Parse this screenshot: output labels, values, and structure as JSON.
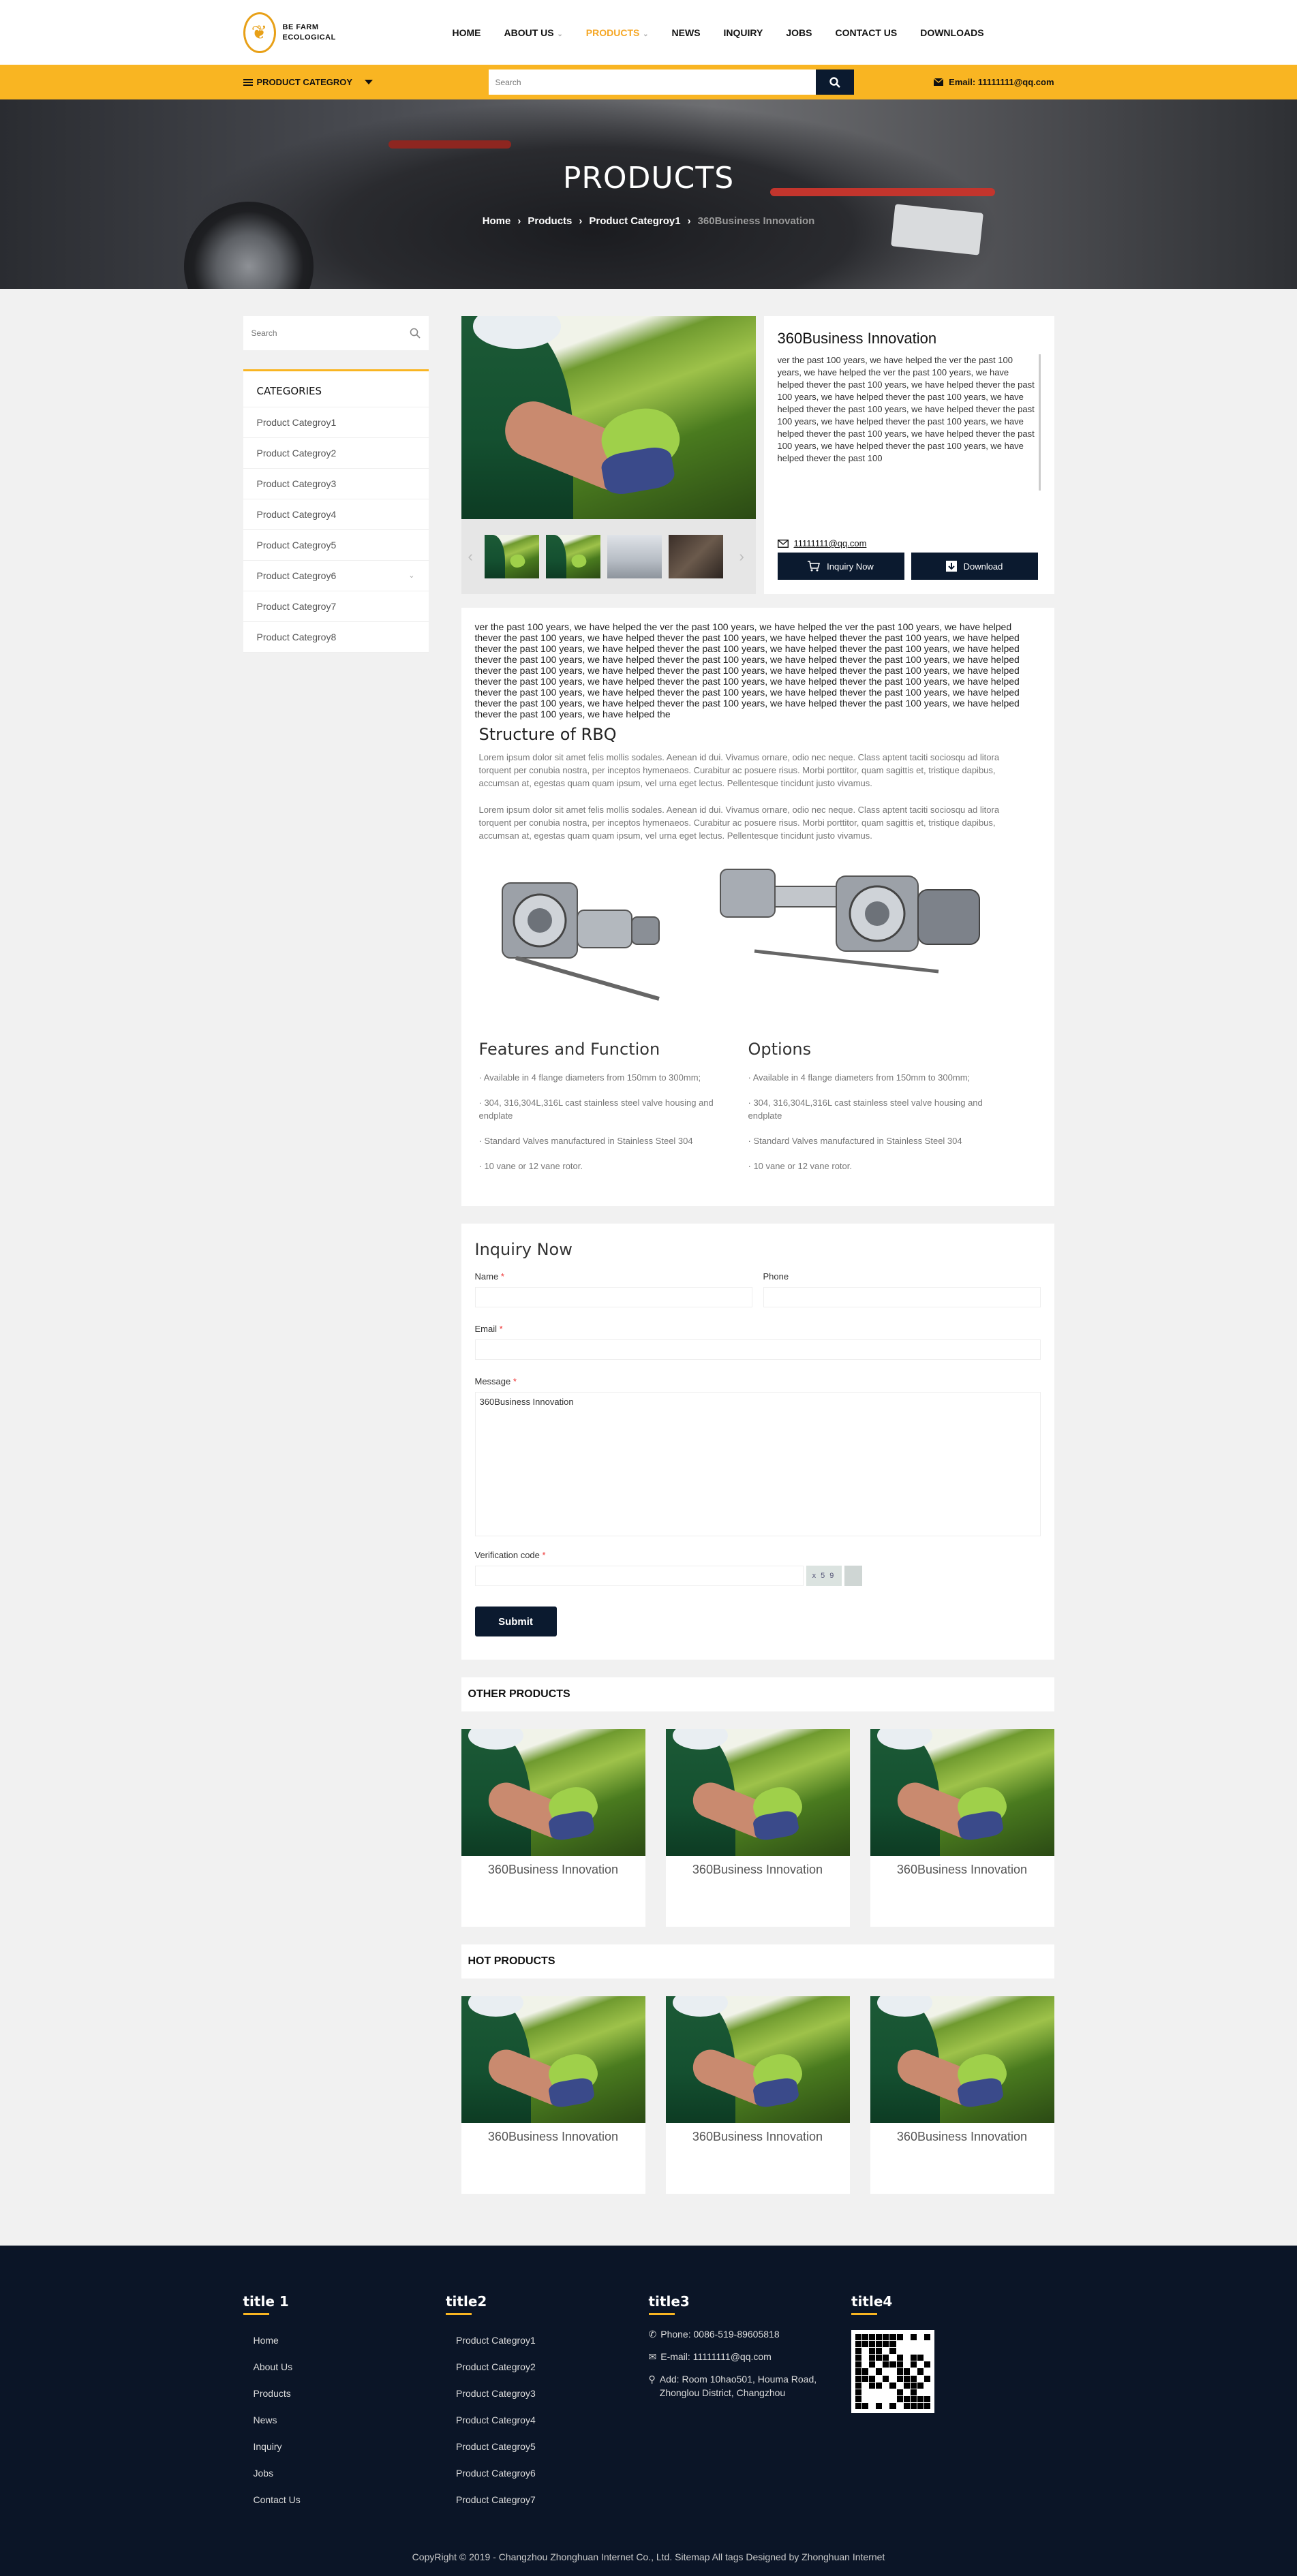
{
  "header": {
    "logo_line1": "BE FARM",
    "logo_line2": "ECOLOGICAL",
    "nav": [
      "HOME",
      "ABOUT US",
      "PRODUCTS",
      "NEWS",
      "INQUIRY",
      "JOBS",
      "CONTACT US",
      "DOWNLOADS"
    ],
    "active_nav": "PRODUCTS"
  },
  "topbar": {
    "category_label": "PRODUCT CATEGROY",
    "search_placeholder": "Search",
    "email": "Email: 11111111@qq.com"
  },
  "banner": {
    "title": "PRODUCTS",
    "breadcrumb": [
      "Home",
      "Products",
      "Product Categroy1",
      "360Business Innovation"
    ]
  },
  "sidebar": {
    "search_placeholder": "Search",
    "categories_title": "CATEGORIES",
    "categories": [
      "Product Categroy1",
      "Product Categroy2",
      "Product Categroy3",
      "Product Categroy4",
      "Product Categroy5",
      "Product Categroy6",
      "Product Categroy7",
      "Product Categroy8"
    ]
  },
  "product": {
    "title": "360Business Innovation",
    "description": "ver the past 100 years, we have helped the ver the past 100 years, we have helped the ver the past 100 years, we have helped thever the past 100 years, we have helped thever the past 100 years, we have helped thever the past 100 years, we have helped thever the past 100 years, we have helped thever the past 100 years, we have helped thever the past 100 years, we have helped thever the past 100 years, we have helped thever the past 100 years, we have helped thever the past 100 years, we have helped thever the past 100",
    "email": "11111111@qq.com",
    "inquiry_button": "Inquiry Now",
    "download_button": "Download"
  },
  "detail": {
    "intro": "ver the past 100 years, we have helped the ver the past 100 years, we have helped the ver the past 100 years, we have helped thever the past 100 years, we have helped thever the past 100 years, we have helped thever the past 100 years, we have helped thever the past 100 years, we have helped thever the past 100 years, we have helped thever the past 100 years, we have helped thever the past 100 years, we have helped thever the past 100 years, we have helped thever the past 100 years, we have helped thever the past 100 years, we have helped thever the past 100 years, we have helped thever the past 100 years, we have helped thever the past 100 years, we have helped thever the past 100 years, we have helped thever the past 100 years, we have helped thever the past 100 years, we have helped thever the past 100 years, we have helped thever the past 100 years, we have helped thever the past 100 years, we have helped thever the past 100 years, we have helped thever the past 100 years, we have helped thever the past 100 years, we have helped the",
    "heading": "Structure of RBQ",
    "para1": "Lorem ipsum dolor sit amet felis mollis sodales. Aenean id dui. Vivamus ornare, odio nec neque. Class aptent taciti sociosqu ad litora torquent per conubia nostra, per inceptos hymenaeos. Curabitur ac posuere risus. Morbi porttitor, quam sagittis et, tristique dapibus, accumsan at, egestas quam quam ipsum, vel urna eget lectus. Pellentesque tincidunt justo vivamus.",
    "para2": "Lorem ipsum dolor sit amet felis mollis sodales. Aenean id dui. Vivamus ornare, odio nec neque. Class aptent taciti sociosqu ad litora torquent per conubia nostra, per inceptos hymenaeos. Curabitur ac posuere risus. Morbi porttitor, quam sagittis et, tristique dapibus, accumsan at, egestas quam quam ipsum, vel urna eget lectus. Pellentesque tincidunt justo vivamus.",
    "features_title": "Features and Function",
    "features": [
      "· Available in 4 flange diameters from 150mm to 300mm;",
      "· 304, 316,304L,316L cast stainless steel valve housing and endplate",
      "· Standard Valves manufactured in Stainless Steel 304",
      "· 10 vane or 12 vane rotor."
    ],
    "options_title": "Options",
    "options": [
      "· Available in 4 flange diameters from 150mm to 300mm;",
      "· 304, 316,304L,316L cast stainless steel valve housing and endplate",
      "· Standard Valves manufactured in Stainless Steel 304",
      "· 10 vane or 12 vane rotor."
    ]
  },
  "inquiry": {
    "title": "Inquiry Now",
    "name_label": "Name",
    "phone_label": "Phone",
    "email_label": "Email",
    "message_label": "Message",
    "message_value": "360Business Innovation",
    "verification_label": "Verification code",
    "captcha_text": "x 5 9",
    "required_mark": "*",
    "submit": "Submit"
  },
  "other_products": {
    "title": "OTHER PRODUCTS",
    "items": [
      "360Business Innovation",
      "360Business Innovation",
      "360Business Innovation"
    ]
  },
  "hot_products": {
    "title": "HOT PRODUCTS",
    "items": [
      "360Business Innovation",
      "360Business Innovation",
      "360Business Innovation"
    ]
  },
  "footer": {
    "col1_title": "title 1",
    "col1_links": [
      "Home",
      "About Us",
      "Products",
      "News",
      "Inquiry",
      "Jobs",
      "Contact Us"
    ],
    "col2_title": "title2",
    "col2_links": [
      "Product Categroy1",
      "Product Categroy2",
      "Product Categroy3",
      "Product Categroy4",
      "Product Categroy5",
      "Product Categroy6",
      "Product Categroy7"
    ],
    "col3_title": "title3",
    "phone": "Phone: 0086-519-89605818",
    "email": "E-mail: 11111111@qq.com",
    "address": "Add: Room 10hao501, Houma Road, Zhonglou District, Changzhou",
    "col4_title": "title4",
    "copyright": "CopyRight © 2019 -   Changzhou Zhonghuan Internet Co., Ltd.   Sitemap  All tags  Designed by Zhonghuan Internet"
  },
  "colors": {
    "accent": "#f9b522",
    "navy": "#0b1a2f",
    "footer_bg": "#0b1527"
  }
}
